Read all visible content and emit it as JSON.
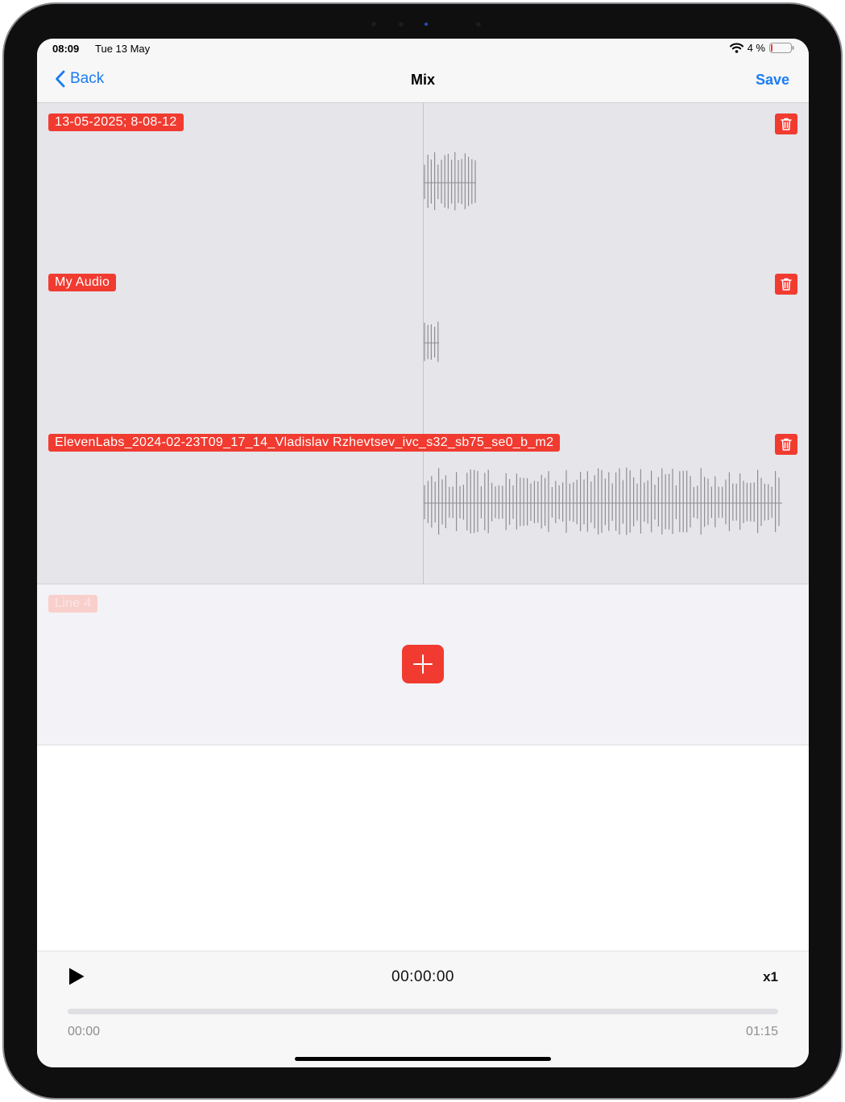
{
  "status_bar": {
    "time": "08:09",
    "date": "Tue 13 May",
    "battery": "4 %"
  },
  "nav": {
    "back_label": "Back",
    "title": "Mix",
    "save_label": "Save"
  },
  "tracks": [
    {
      "label": "13-05-2025; 8-08-12"
    },
    {
      "label": "My Audio"
    },
    {
      "label": "ElevenLabs_2024-02-23T09_17_14_Vladislav Rzhevtsev_ivc_s32_sb75_se0_b_m2"
    }
  ],
  "empty_track": {
    "label": "Line 4"
  },
  "player": {
    "current_time": "00:00:00",
    "speed": "x1",
    "start_time": "00:00",
    "end_time": "01:15",
    "progress": 0
  },
  "colors": {
    "accent": "#f13b30",
    "link": "#1a7cf2",
    "track_bg": "#e5e5ea",
    "waveform": "#8e8e93"
  },
  "icons": {
    "back": "chevron-left-icon",
    "delete": "trash-icon",
    "add": "plus-icon",
    "play": "play-icon",
    "wifi": "wifi-icon",
    "battery": "battery-icon"
  }
}
